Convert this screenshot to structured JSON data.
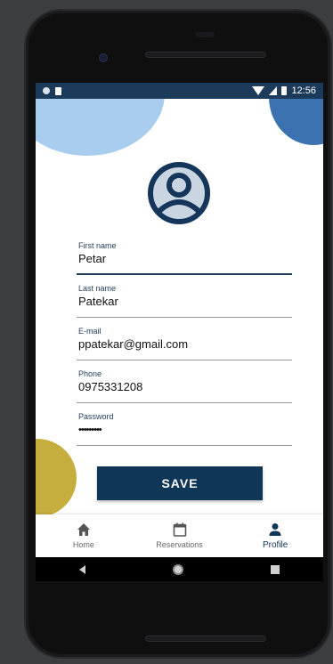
{
  "status_bar": {
    "time": "12:56"
  },
  "avatar": {
    "icon": "user-circle-icon"
  },
  "form": {
    "first_name": {
      "label": "First name",
      "value": "Petar"
    },
    "last_name": {
      "label": "Last name",
      "value": "Patekar"
    },
    "email": {
      "label": "E-mail",
      "value": "ppatekar@gmail.com"
    },
    "phone": {
      "label": "Phone",
      "value": "0975331208"
    },
    "password": {
      "label": "Password",
      "value": "•••••••••"
    }
  },
  "save_button": {
    "label": "SAVE"
  },
  "bottom_nav": {
    "items": [
      {
        "label": "Home",
        "icon": "home-icon"
      },
      {
        "label": "Reservations",
        "icon": "calendar-icon"
      },
      {
        "label": "Profile",
        "icon": "person-icon",
        "active": true
      }
    ]
  },
  "colors": {
    "primary": "#0f3557",
    "status_bar": "#1c3a5a",
    "accent_light_blue": "#a8cdee",
    "accent_blue": "#3c72b0",
    "accent_gold": "#c5ae3d"
  }
}
